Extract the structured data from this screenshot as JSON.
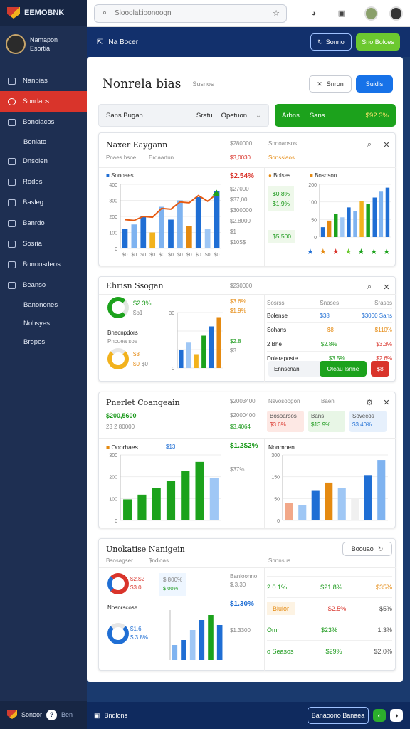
{
  "app": {
    "name": "EEMOBNK"
  },
  "user": {
    "name": "Namapon",
    "role": "Esortia"
  },
  "nav": [
    {
      "label": "Nanpias",
      "icon": "home-icon"
    },
    {
      "label": "Sonrlacs",
      "icon": "globe-icon",
      "active": true
    },
    {
      "label": "Bonolacos",
      "icon": "folder-icon"
    },
    {
      "label": "Bonlato",
      "icon": "",
      "sub": true
    },
    {
      "label": "Dnsolen",
      "icon": "calendar-icon"
    },
    {
      "label": "Rodes",
      "icon": "users-icon"
    },
    {
      "label": "Basleg",
      "icon": "gear-icon"
    },
    {
      "label": "Banrdo",
      "icon": "grid-icon"
    },
    {
      "label": "Sosria",
      "icon": "doc-icon"
    },
    {
      "label": "Bonoosdeos",
      "icon": "user-icon"
    },
    {
      "label": "Beanso",
      "icon": "box-icon"
    },
    {
      "label": "Banonones",
      "icon": "",
      "sub": true
    },
    {
      "label": "Nohsyes",
      "icon": "",
      "sub": true
    },
    {
      "label": "Bropes",
      "icon": "",
      "sub": true
    }
  ],
  "sidefoot": {
    "label": "Sonoor",
    "qbtn": "?",
    "extra": "Ben"
  },
  "search": {
    "placeholder": "Slooolal:ioonoogn"
  },
  "band": {
    "title": "Na Bocer",
    "btn_outline": "Sonno",
    "btn_green": "Sno Bolces"
  },
  "page": {
    "title": "Nonrela bias",
    "subtitle": "Susnos",
    "btn_close": "Snron",
    "btn_blue": "Suidis"
  },
  "filter": {
    "label": "Sans Bugan",
    "mid": "Sratu",
    "select": "Opetuon",
    "green_label": "Arbns",
    "green_mid": "Sans",
    "green_value": "$92.3%"
  },
  "card1": {
    "title": "Naxer Eaygann",
    "tab1": "Pnaes hsoe",
    "tab2": "Erdaartun",
    "top1": "$280000",
    "top1b": "$3,0030",
    "top2": "Snnoaosos",
    "top2b": "Sonssiaos",
    "legend": "Sonoaes",
    "value": "$2.54%",
    "rs": [
      "$27000",
      "$37,00",
      "$300000",
      "$2.8000",
      "$1",
      "$10$$"
    ],
    "right_legend_a": "Bolses",
    "right_legend_b": "Bosnson",
    "right_stats": [
      "$0.8%",
      "$1.9%",
      "$5,500"
    ],
    "chart_data": {
      "type": "bar",
      "categories": [
        "$0",
        "$0",
        "$0",
        "$0",
        "$0",
        "$0",
        "$0",
        "$0",
        "$0",
        "$0",
        "$0"
      ],
      "ylim": [
        0,
        400
      ],
      "yticks": [
        "400",
        "300",
        "200",
        "100",
        "0"
      ],
      "series": [
        {
          "values": [
            120,
            150,
            200,
            100,
            260,
            180,
            300,
            140,
            320,
            120,
            360
          ]
        },
        {
          "values": [
            80,
            60,
            70,
            50,
            90,
            70,
            100,
            80,
            110,
            60,
            90
          ]
        }
      ]
    },
    "chart_data_2": {
      "type": "bar",
      "yticks": [
        "200",
        "100",
        "50",
        "0"
      ],
      "values": [
        30,
        50,
        70,
        60,
        90,
        80,
        110,
        100,
        120,
        140,
        150
      ]
    }
  },
  "card2": {
    "title": "Ehrisn Ssogan",
    "donut1": "$2.3%",
    "donut1b": "$b1",
    "line1": "Bnecnpdors",
    "line2": "Pncuea soe",
    "donut2": "$3",
    "donut2b": "$0",
    "donut2c": "$0",
    "top": "$2$0000",
    "r1": "$3.6%",
    "r2": "$1.9%",
    "r3": "$2.8",
    "r4": "$3",
    "headers": [
      "Sosrss",
      "Snases",
      "Srasos"
    ],
    "rows": [
      [
        "Bolense",
        "$38",
        "$3000 Sans"
      ],
      [
        "Sohans",
        "$8",
        "$110%"
      ],
      [
        "2 Bhe",
        "$2.8%",
        "$3.3%"
      ],
      [
        "Doleraposte",
        "$3.5%",
        "$2.6%"
      ]
    ],
    "foot_label": "Ennscnan",
    "btn_green": "Olcau lsnne",
    "btn_red": "$8"
  },
  "card3": {
    "title": "Pnerlet Coangeain",
    "v1": "$200,5600",
    "v2": "23 2 80000",
    "r1": "$2003400",
    "r2": "$2000400",
    "r3": "$3.4064",
    "tagline": "Ooorhaes",
    "tagvalue": "$13",
    "pct": "$1.2$2%",
    "pct2": "$37%",
    "tags": [
      {
        "label": "Bosoarsos",
        "value": "$3.6%",
        "tone": "red"
      },
      {
        "label": "Bans",
        "value": "$13.9%",
        "tone": "green"
      },
      {
        "label": "Sovecos",
        "value": "$3.40%",
        "tone": "blue"
      }
    ],
    "right_title": "Nonmnen",
    "chart_data": {
      "type": "bar",
      "yticks": [
        "300",
        "200",
        "100",
        "0"
      ],
      "values": [
        90,
        110,
        140,
        170,
        210,
        250,
        180
      ]
    },
    "chart_data_2": {
      "type": "bar",
      "yticks": [
        "300",
        "150",
        "50",
        "0"
      ],
      "values": [
        70,
        60,
        120,
        150,
        130,
        90,
        180,
        240
      ]
    },
    "right_header": "Nsvosoogon",
    "right_header2": "Baen"
  },
  "card4": {
    "title": "Unokatise Nanigein",
    "btn": "Boouao",
    "tab1": "Bsosagser",
    "tab2": "$ndioas",
    "d1": "$2.$2",
    "d2": "$3.0",
    "d1b": "$ 800%",
    "d2b": "$ 00%",
    "h1": "Nosnrscose",
    "v": "$1.30%",
    "r1": "$.3.30",
    "r2": "$1.3300",
    "col_headers": [
      "Banloonno",
      "Snnnsus"
    ],
    "rows": [
      [
        "2 0.1%",
        "$21.8%",
        "$35%"
      ],
      [
        "Bluior",
        "$2.5%",
        "$5%"
      ],
      [
        "Omn",
        "$23%",
        "1.3%"
      ],
      [
        "o Seasos",
        "$29%",
        "$2.0%"
      ]
    ],
    "d3": "$1.6",
    "d3b": "$ 3.8%",
    "chart_data": {
      "type": "bar",
      "values": [
        30,
        40,
        60,
        80,
        90,
        70
      ]
    }
  },
  "bottom": {
    "label": "Bndlons",
    "btn": "Banaoono Banaea"
  }
}
